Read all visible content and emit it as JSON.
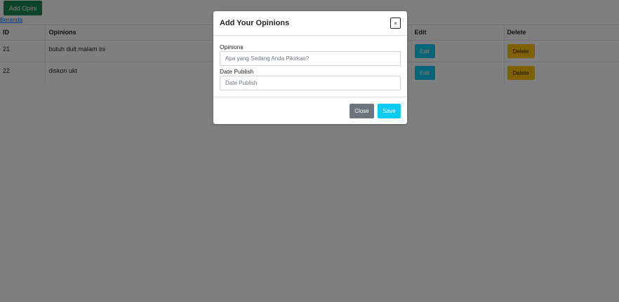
{
  "toolbar": {
    "add_label": "Add Opini",
    "home_link": "Beranda"
  },
  "table": {
    "headers": [
      "ID",
      "Opinions",
      "Edit",
      "Delete"
    ],
    "rows": [
      {
        "id": "21",
        "opinion": "butuh duit malam ini",
        "edit": "Edit",
        "delete": "Delete"
      },
      {
        "id": "22",
        "opinion": "diskon ukt",
        "edit": "Edit",
        "delete": "Delete"
      }
    ]
  },
  "modal": {
    "title": "Add Your Opinions",
    "close_icon": "×",
    "opinions_label": "Opinions",
    "opinions_placeholder": "Apa yang Sedang Anda Pikirkan?",
    "date_label": "Date Publish",
    "date_placeholder": "Date Publish",
    "close_label": "Close",
    "save_label": "Save"
  },
  "colors": {
    "success": "#198754",
    "info": "#0dcaf0",
    "warning": "#ffc107",
    "secondary": "#6c757d"
  }
}
